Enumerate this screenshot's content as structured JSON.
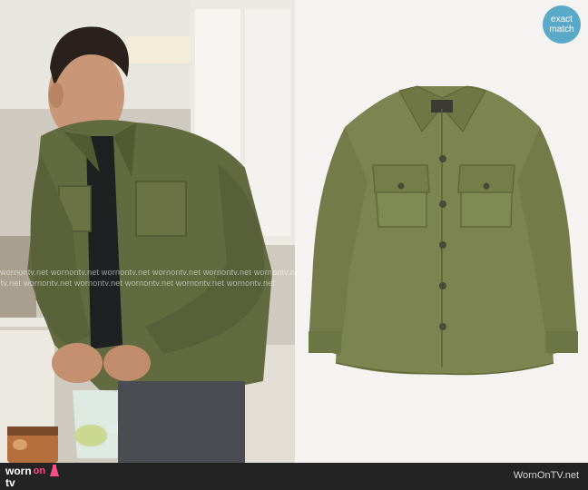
{
  "badge": {
    "line1": "exact",
    "line2": "match"
  },
  "watermark": {
    "text": "wornontv.net  wornontv.net  wornontv.net  wornontv.net  wornontv.net  wornontv.net"
  },
  "footer": {
    "logo_word1": "worn",
    "logo_word2": "on",
    "logo_word3": "tv",
    "site_url": "WornOnTV.net"
  },
  "colors": {
    "jacket_olive": "#7c8550",
    "jacket_dark": "#4f5732",
    "badge_blue": "#5aa9c9",
    "logo_pink": "#ff4f8b",
    "footer_bg": "#232323"
  },
  "icons": {
    "logo_icon": "dress-icon"
  }
}
